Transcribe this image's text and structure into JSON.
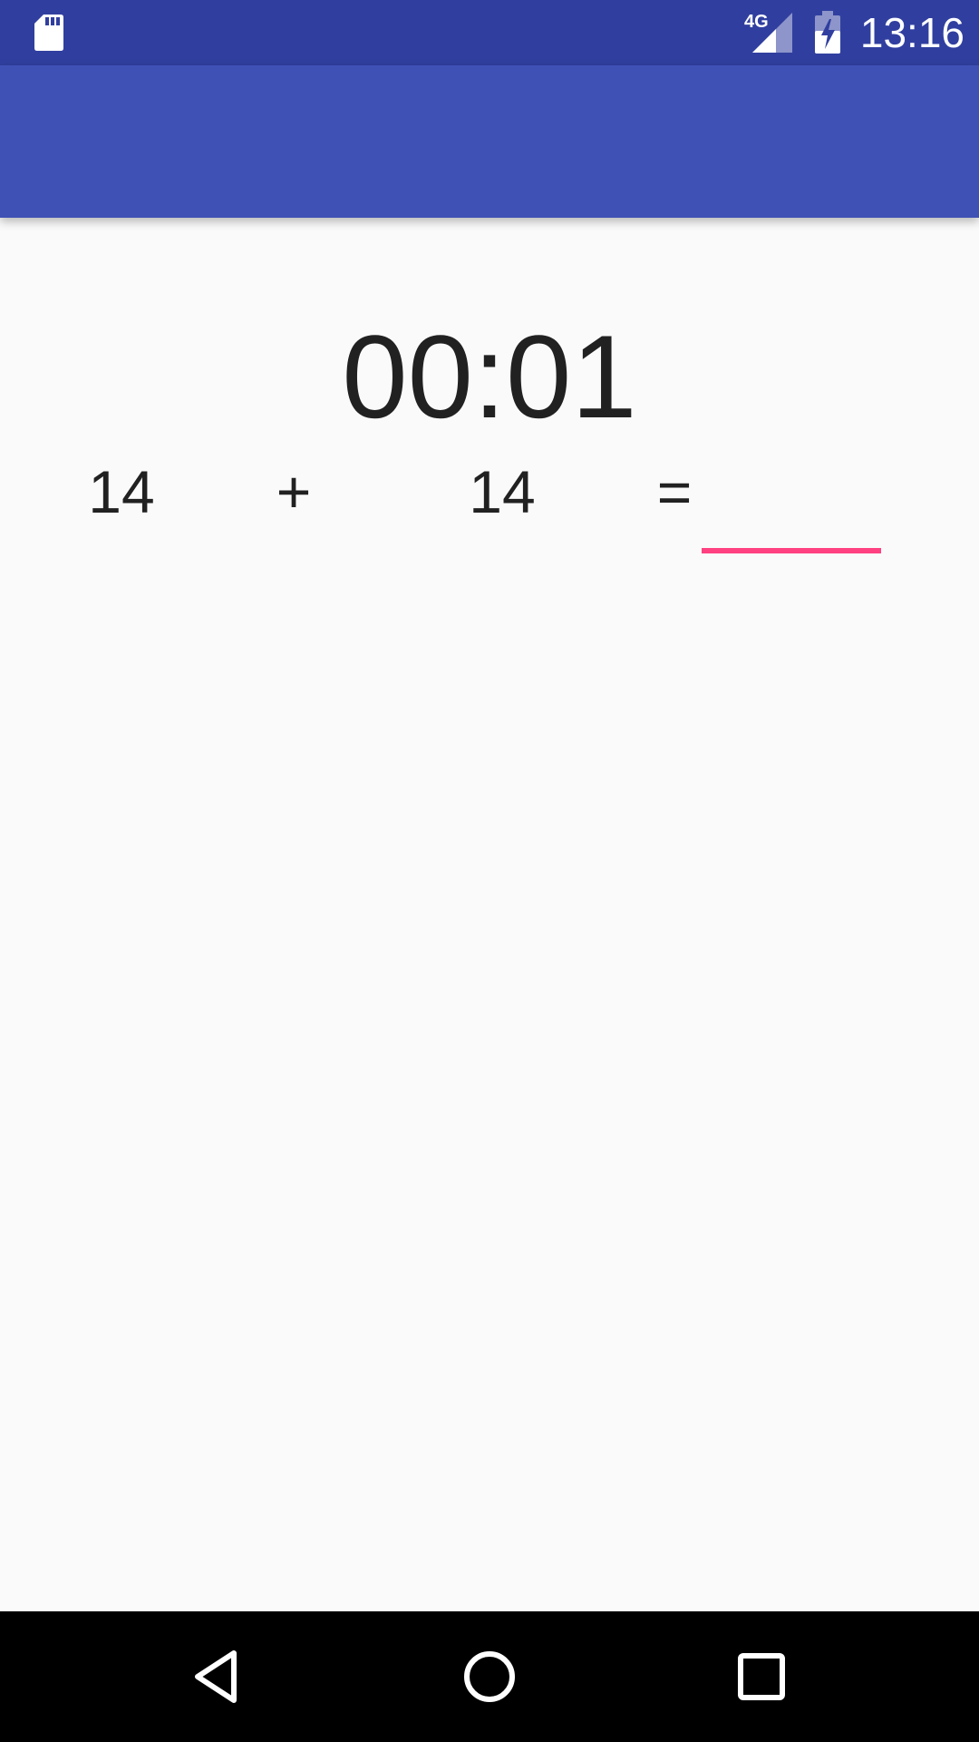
{
  "status_bar": {
    "time": "13:16",
    "network_label": "4G",
    "icons": [
      "sd-card-icon",
      "signal-4g-icon",
      "battery-charging-icon"
    ],
    "background": "#303F9F"
  },
  "app_bar": {
    "background": "#3F51B5"
  },
  "quiz": {
    "timer": "00:01",
    "operand_a": "14",
    "operator": "+",
    "operand_b": "14",
    "equals": "=",
    "answer_value": "",
    "answer_underline_color": "#FF4081"
  },
  "nav_bar": {
    "icons": [
      "back-icon",
      "home-icon",
      "recents-icon"
    ],
    "background": "#000000"
  }
}
